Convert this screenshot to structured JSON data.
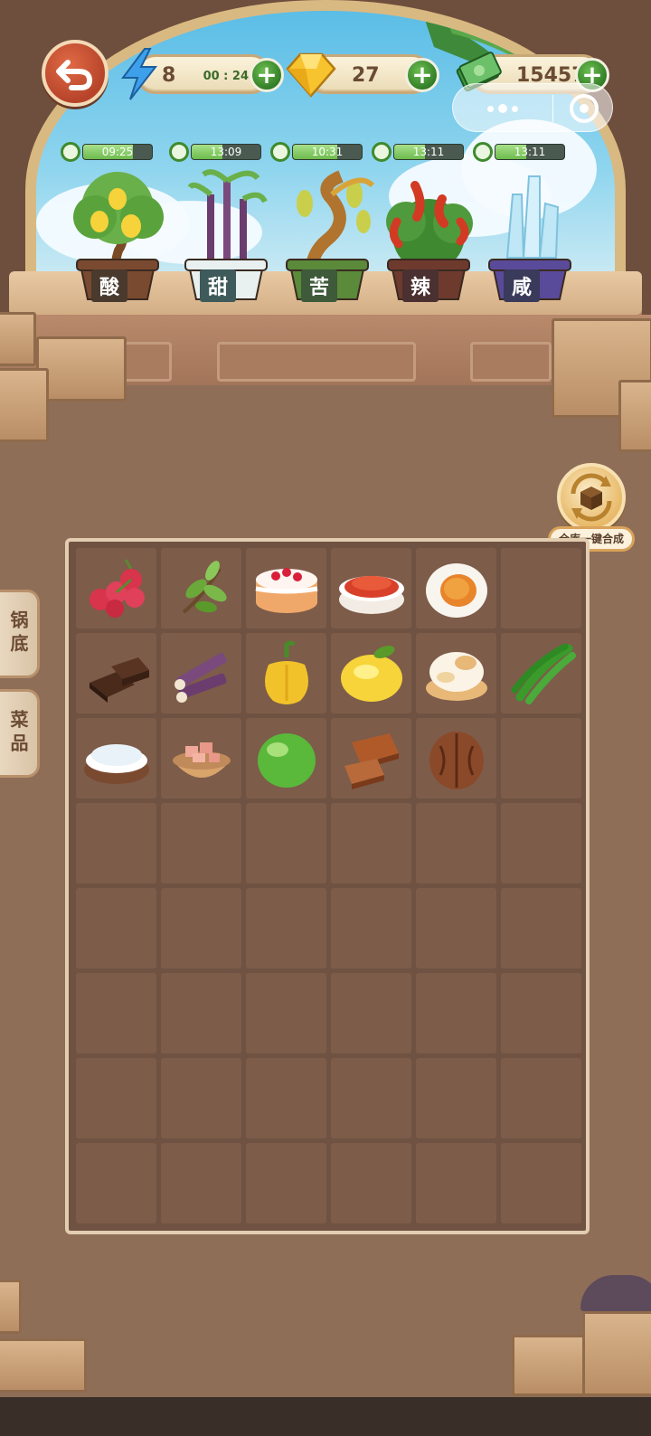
{
  "hud": {
    "energy": {
      "value": "8",
      "timer": "00 : 24",
      "icon": "lightning-icon"
    },
    "gems": {
      "value": "27",
      "icon": "gem-icon"
    },
    "cash": {
      "value": "15457",
      "icon": "cash-stack-icon"
    },
    "plus_label": "+"
  },
  "plants": [
    {
      "flavor": "酸",
      "timer": "09:25",
      "progress": 0.72,
      "plant": "lemon-tree",
      "label_color": "#4a3a2e"
    },
    {
      "flavor": "甜",
      "timer": "13:09",
      "progress": 0.45,
      "plant": "sugarcane",
      "label_color": "#3e5a5a"
    },
    {
      "flavor": "苦",
      "timer": "10:31",
      "progress": 0.65,
      "plant": "bitter-gourd-tree",
      "label_color": "#3e5a3a"
    },
    {
      "flavor": "辣",
      "timer": "13:11",
      "progress": 0.45,
      "plant": "chili-plant",
      "label_color": "#4a3030"
    },
    {
      "flavor": "咸",
      "timer": "13:11",
      "progress": 0.45,
      "plant": "salt-crystal",
      "label_color": "#3a3a5a"
    }
  ],
  "side_tabs": [
    {
      "label": "锅底"
    },
    {
      "label": "菜品"
    }
  ],
  "merge_button": {
    "label": "仓库一键合成",
    "icon": "box-cycle-icon"
  },
  "inventory": {
    "rows": [
      [
        "lychee",
        "tea-leaves",
        "strawberry-cake",
        "chili-powder",
        "salted-egg",
        ""
      ],
      [
        "dark-chocolate",
        "sugarcane-pieces",
        "yellow-pepper",
        "lemon",
        "cream-puff",
        "green-chili"
      ],
      [
        "salt-bowl",
        "diced-meat-bowl",
        "lime",
        "caramel-toffee",
        "walnut",
        ""
      ],
      [
        "",
        "",
        "",
        "",
        "",
        ""
      ],
      [
        "",
        "",
        "",
        "",
        "",
        ""
      ],
      [
        "",
        "",
        "",
        "",
        "",
        ""
      ],
      [
        "",
        "",
        "",
        "",
        "",
        ""
      ],
      [
        "",
        "",
        "",
        "",
        "",
        ""
      ]
    ]
  }
}
